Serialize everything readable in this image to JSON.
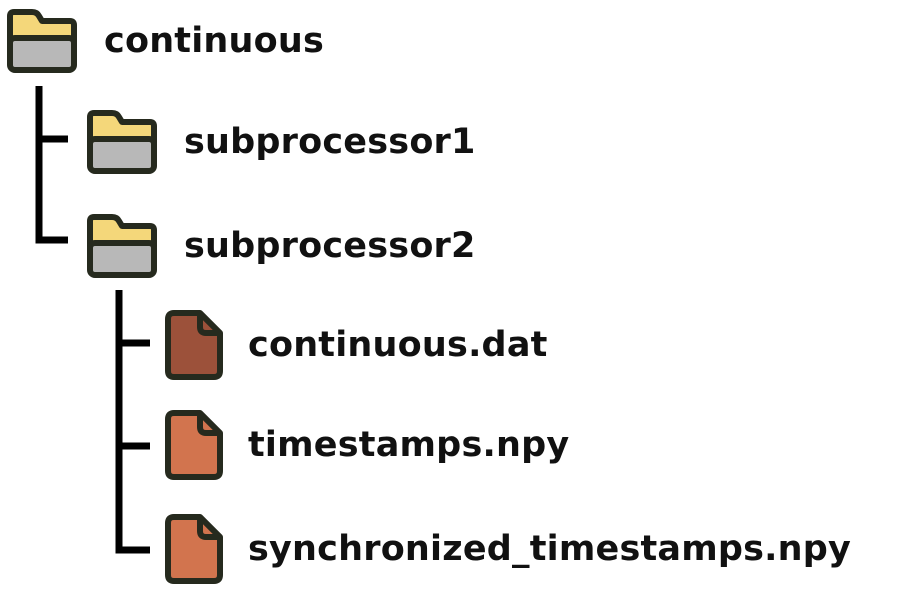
{
  "tree": {
    "root": {
      "label": "continuous",
      "icon": "folder-icon",
      "children": [
        {
          "label": "subprocessor1",
          "icon": "folder-icon"
        },
        {
          "label": "subprocessor2",
          "icon": "folder-icon",
          "children": [
            {
              "label": "continuous.dat",
              "icon": "file-icon",
              "color": "#9c513a"
            },
            {
              "label": "timestamps.npy",
              "icon": "file-icon",
              "color": "#d2744e"
            },
            {
              "label": "synchronized_timestamps.npy",
              "icon": "file-icon",
              "color": "#d2744e"
            }
          ]
        }
      ]
    }
  },
  "colors": {
    "folder_tab": "#f4d77a",
    "folder_body": "#b8b8b8",
    "outline": "#262a1e",
    "connector": "#000000"
  }
}
